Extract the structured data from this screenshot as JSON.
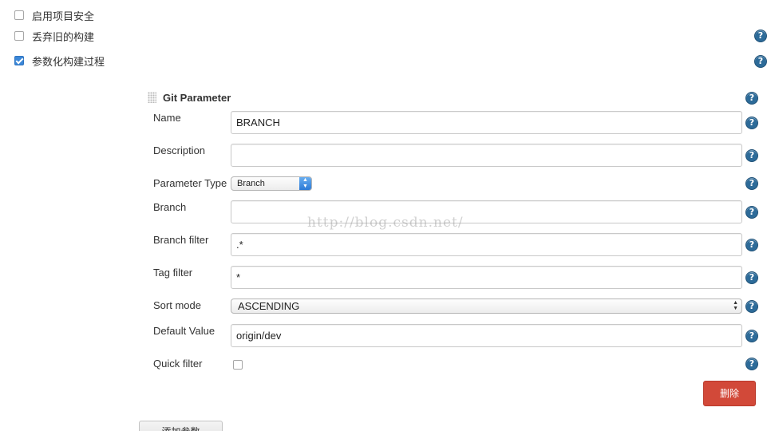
{
  "options": {
    "project_security": {
      "label": "启用项目安全",
      "checked": false
    },
    "discard_old_builds": {
      "label": "丢弃旧的构建",
      "checked": false
    },
    "parameterized": {
      "label": "参数化构建过程",
      "checked": true
    }
  },
  "git_parameter": {
    "title": "Git Parameter",
    "fields": {
      "name": {
        "label": "Name",
        "value": "BRANCH"
      },
      "description": {
        "label": "Description",
        "value": ""
      },
      "parameter_type": {
        "label": "Parameter Type",
        "value": "Branch"
      },
      "branch": {
        "label": "Branch",
        "value": ""
      },
      "branch_filter": {
        "label": "Branch filter",
        "value": ".*"
      },
      "tag_filter": {
        "label": "Tag filter",
        "value": "*"
      },
      "sort_mode": {
        "label": "Sort mode",
        "value": "ASCENDING"
      },
      "default_value": {
        "label": "Default Value",
        "value": "origin/dev"
      },
      "quick_filter": {
        "label": "Quick filter",
        "checked": false
      }
    },
    "delete_label": "删除"
  },
  "add_parameter_label": "添加参数",
  "help_symbol": "?",
  "watermark": "http://blog.csdn.net/",
  "colors": {
    "help": "#2d6b99",
    "delete": "#d24939",
    "checkbox_checked": "#3b87d8"
  }
}
